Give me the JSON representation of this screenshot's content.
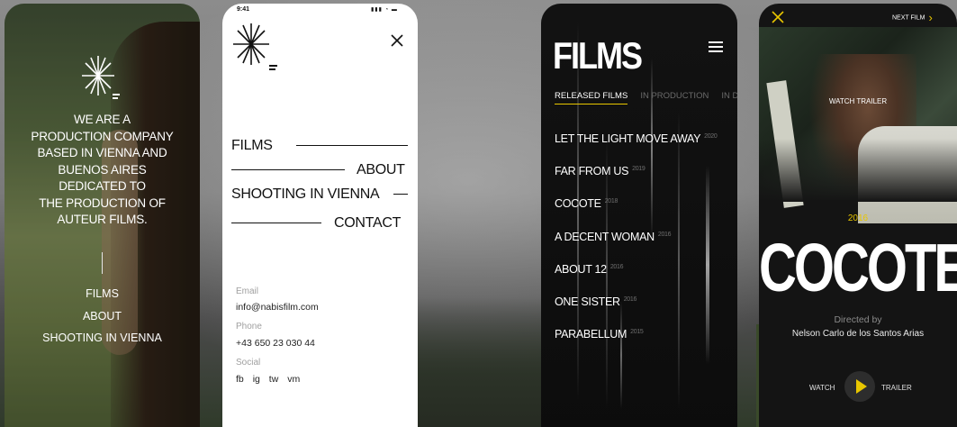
{
  "colors": {
    "accent_yellow": "#e8c600",
    "dark_bg": "#141414",
    "white": "#ffffff"
  },
  "screen1": {
    "headline_lines": [
      "WE ARE A",
      "PRODUCTION COMPANY",
      "BASED IN VIENNA AND",
      "BUENOS AIRES",
      "DEDICATED TO",
      "THE PRODUCTION OF",
      "AUTEUR FILMS."
    ],
    "nav": [
      "FILMS",
      "ABOUT",
      "SHOOTING IN VIENNA"
    ]
  },
  "screen2": {
    "status_time": "9:41",
    "status_icons": "▮▮▮ ◔ ▬",
    "menu": [
      "FILMS",
      "ABOUT",
      "SHOOTING IN VIENNA",
      "CONTACT"
    ],
    "email_label": "Email",
    "email_value": "info@nabisfilm.com",
    "phone_label": "Phone",
    "phone_value": "+43 650 23 030 44",
    "social_label": "Social",
    "social_links": [
      "fb",
      "ig",
      "tw",
      "vm"
    ]
  },
  "screen3": {
    "title": "FILMS",
    "tabs": [
      "RELEASED FILMS",
      "IN PRODUCTION",
      "IN DEV"
    ],
    "films": [
      {
        "name": "LET THE LIGHT MOVE AWAY",
        "year": "2020"
      },
      {
        "name": "FAR FROM US",
        "year": "2019"
      },
      {
        "name": "COCOTE",
        "year": "2018"
      },
      {
        "name": "A DECENT WOMAN",
        "year": "2016"
      },
      {
        "name": "ABOUT 12",
        "year": "2016"
      },
      {
        "name": "ONE SISTER",
        "year": "2016"
      },
      {
        "name": "PARABELLUM",
        "year": "2015"
      }
    ]
  },
  "screen4": {
    "next_film": "NEXT FILM",
    "watch_trailer_top": "WATCH TRAILER",
    "year": "2016",
    "movie_title": "COCOTE",
    "directed_by": "Directed by",
    "director": "Nelson Carlo de los Santos Arias",
    "watch": "WATCH",
    "trailer": "TRAILER"
  }
}
